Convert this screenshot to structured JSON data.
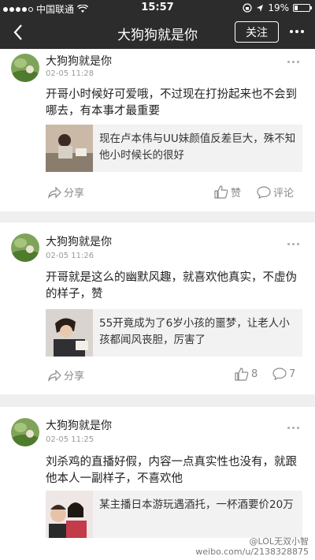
{
  "status_bar": {
    "carrier": "中国联通",
    "time": "15:57",
    "battery": "19%",
    "signal_bars_filled": 4,
    "battery_level": 0.19
  },
  "nav": {
    "title": "大狗狗就是你",
    "follow_label": "关注"
  },
  "posts": [
    {
      "author": "大狗狗就是你",
      "time": "02-05 11:28",
      "text": "开哥小时候好可爱哦，不过现在打扮起来也不会到哪去，有本事才最重要",
      "quote": "现在卢本伟与UU妹颜值反差巨大，殊不知他小时候长的很好",
      "share_label": "分享",
      "like_label": "赞",
      "comment_label": "评论"
    },
    {
      "author": "大狗狗就是你",
      "time": "02-05 11:26",
      "text": "开哥就是这么的幽默风趣，就喜欢他真实，不虚伪的样子，赞",
      "quote": "55开竟成为了6岁小孩的噩梦，让老人小孩都闻风丧胆，厉害了",
      "share_label": "分享",
      "like_label": "8",
      "comment_label": "7"
    },
    {
      "author": "大狗狗就是你",
      "time": "02-05 11:25",
      "text": "刘杀鸡的直播好假，内容一点真实性也没有，就跟他本人一副样子，不喜欢他",
      "quote": "某主播日本游玩遇酒托，一杯酒要价20万"
    }
  ],
  "watermark": {
    "line1": "@LOL无双小智",
    "line2": "weibo.com/u/2138328875"
  },
  "colors": {
    "nav_bg": "#2c2c2c",
    "separator_bg": "#efefef",
    "muted_text": "#9a9a9a"
  }
}
